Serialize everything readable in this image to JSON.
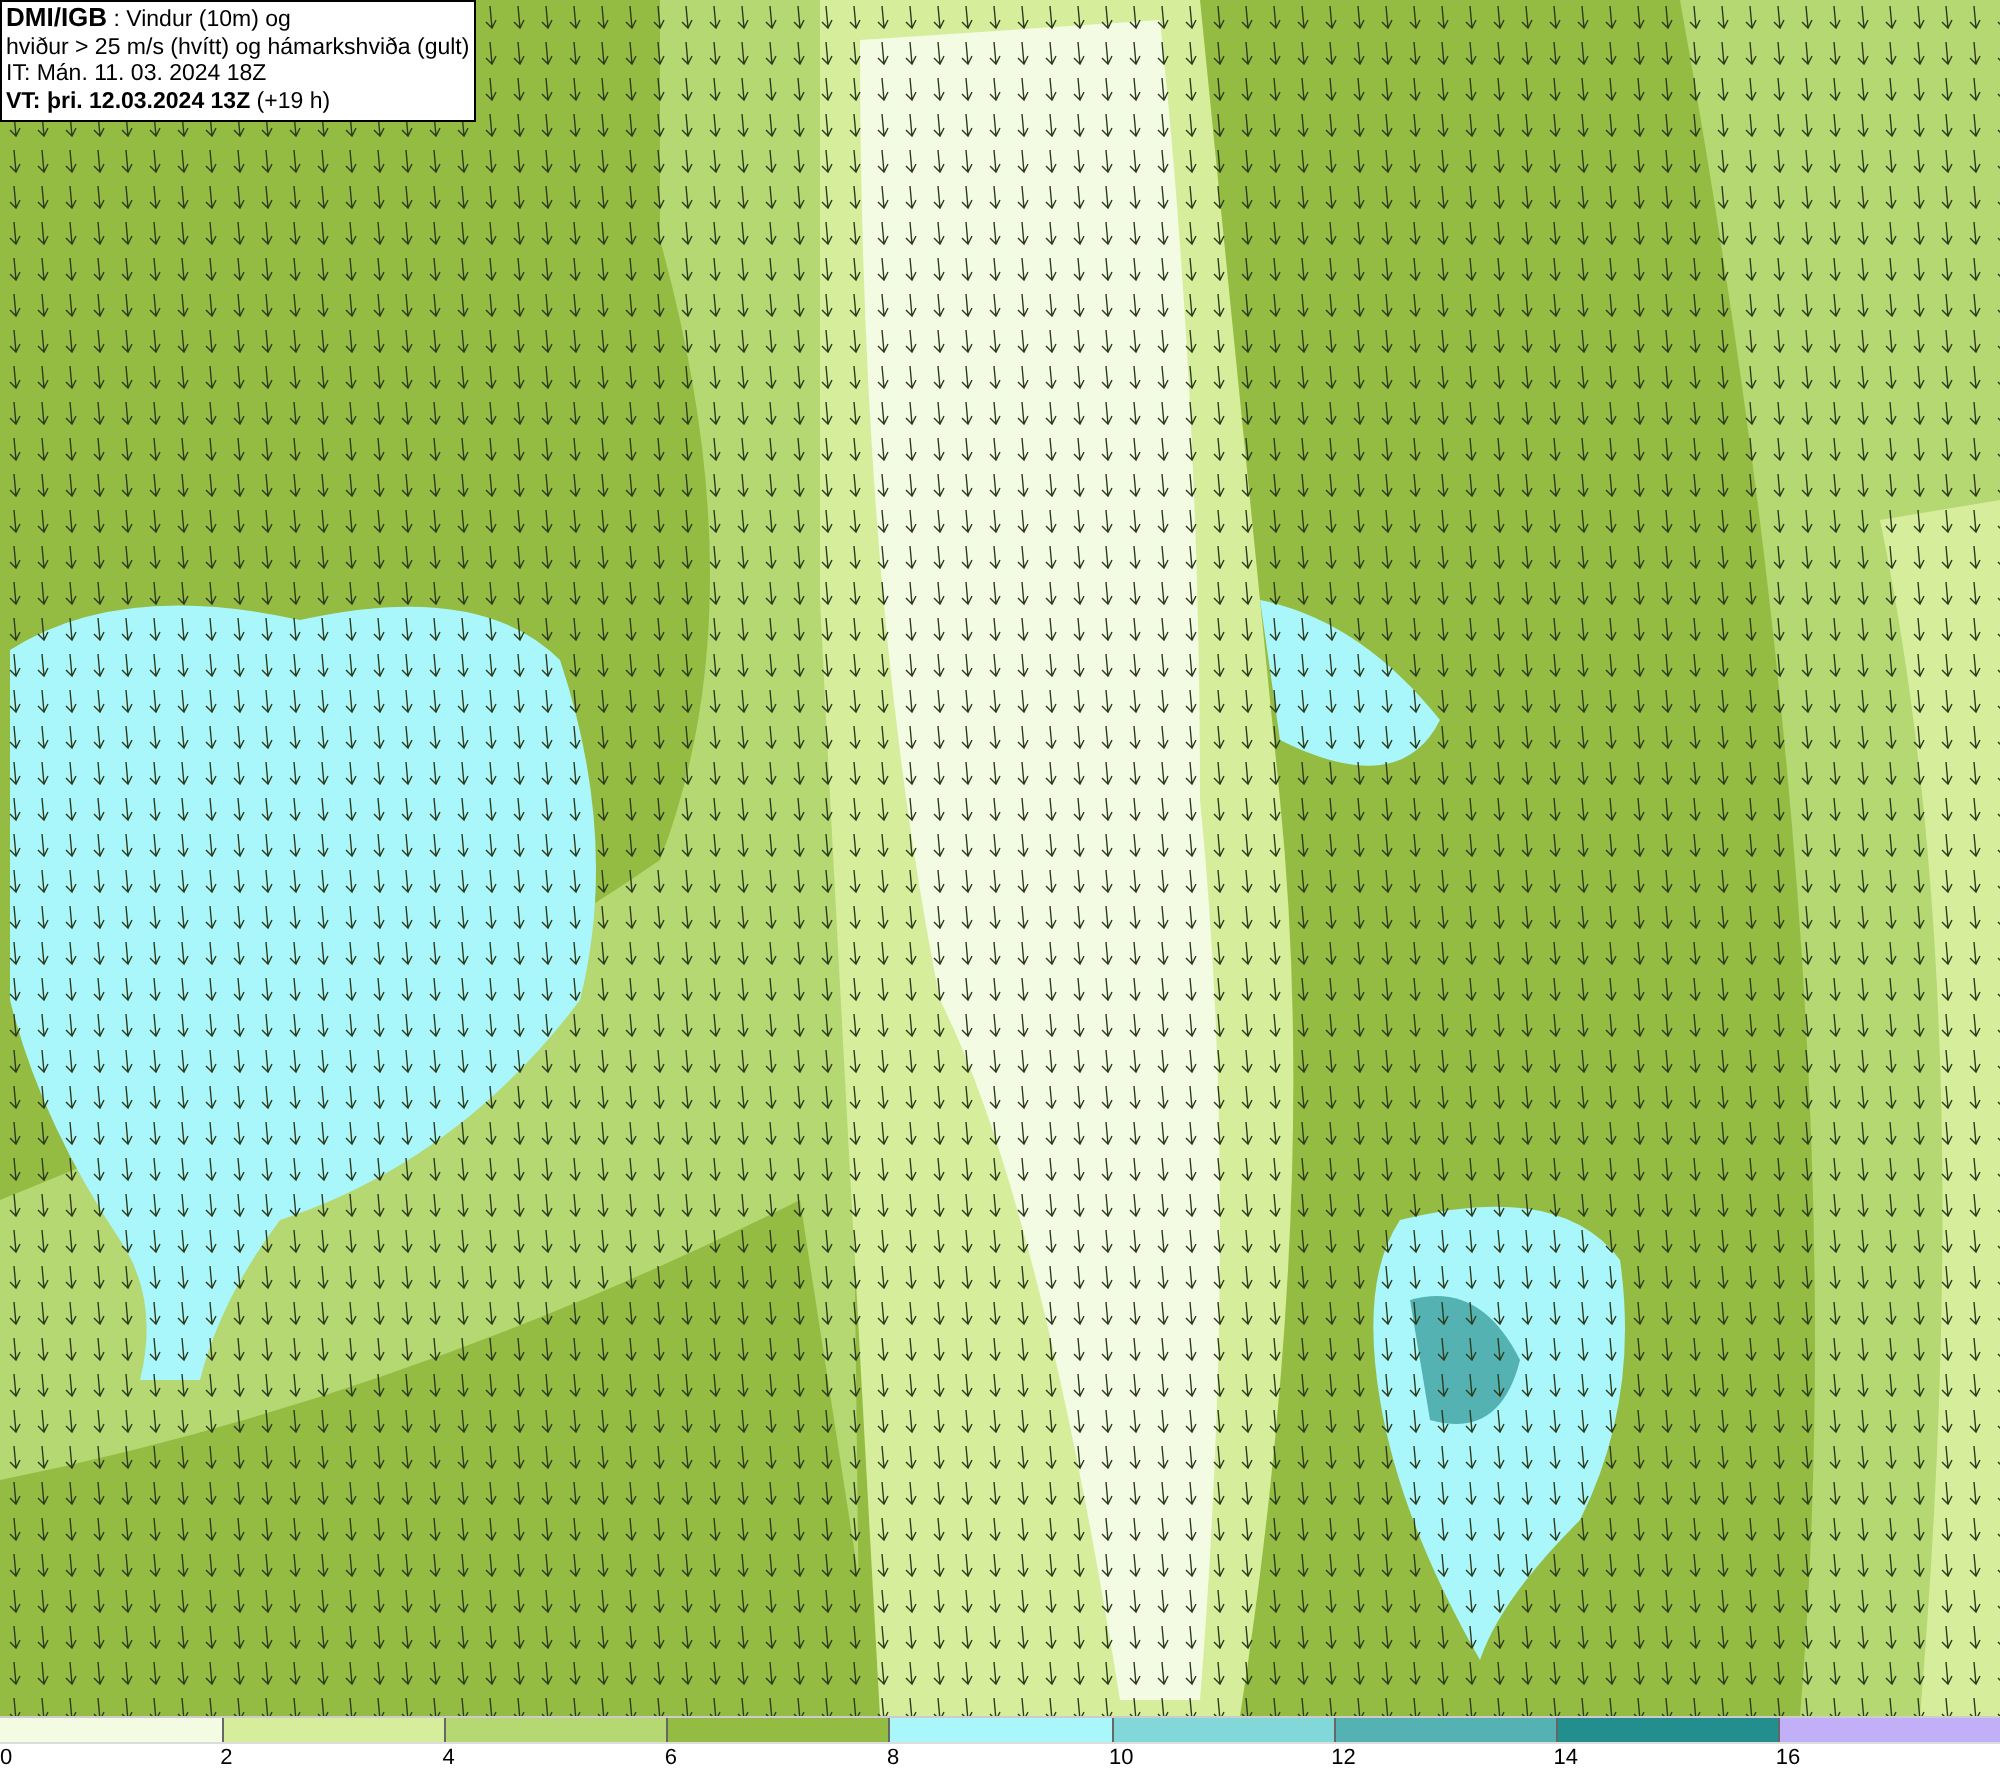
{
  "info_box": {
    "lines": [
      "**DMI/IGB** : Vindur (10m) og",
      "hviður > 25 m/s (hvítt) og hámarkshviða (gult)",
      "IT: Mán. 11. 03. 2024 18Z",
      "**VT: þri. 12.03.2024 13Z** (+19 h)"
    ]
  },
  "legend": {
    "bins": [
      {
        "color": "#f3fbe3"
      },
      {
        "color": "#d6ee9c"
      },
      {
        "color": "#b5d872"
      },
      {
        "color": "#95bc42"
      },
      {
        "color": "#aaf7fb"
      },
      {
        "color": "#82d8d8"
      },
      {
        "color": "#55b2b2"
      },
      {
        "color": "#238e8e"
      },
      {
        "color": "#c1b0f7"
      }
    ],
    "ticks": [
      "0",
      "2",
      "4",
      "6",
      "8",
      "10",
      "12",
      "14",
      "16"
    ]
  }
}
